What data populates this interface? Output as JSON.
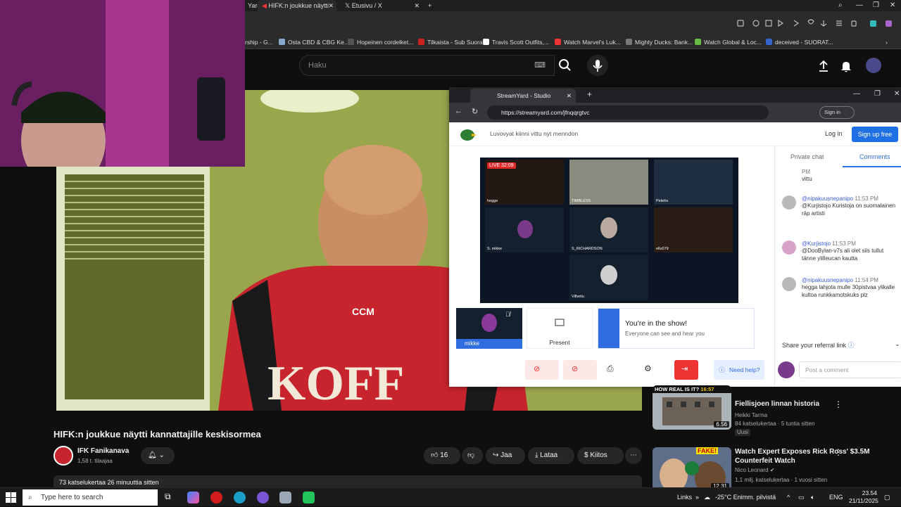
{
  "browser": {
    "tabs": [
      {
        "label": "HIFK:n joukkue näytti",
        "active": true
      },
      {
        "label": "Etusivu / X",
        "active": false
      }
    ],
    "prev_tab_fragment": "Yardi",
    "bookmarks": [
      {
        "label": "rship - G...",
        "color": "#e44"
      },
      {
        "label": "Osta CBD & CBG Ke...",
        "color": "#8ac"
      },
      {
        "label": "Hopeinen cordelket...",
        "color": "#333"
      },
      {
        "label": "Tilkaista - Sub Suora",
        "color": "#c22"
      },
      {
        "label": "Travis Scott Outfits,...",
        "color": "#fff"
      },
      {
        "label": "Watch Marvel's Luk...",
        "color": "#e33"
      },
      {
        "label": "Mighty Ducks: Bank...",
        "color": "#555"
      },
      {
        "label": "Watch Global & Loc...",
        "color": "#6b4"
      },
      {
        "label": "deceived - SUORAT...",
        "color": "#36c"
      }
    ]
  },
  "youtube": {
    "search_placeholder": "Haku",
    "video_title": "HIFK:n joukkue näytti kannattajille keskisormea",
    "channel_name": "IFK Fanikanava",
    "subscribers": "1,58 t. tilaajaa",
    "likes": "16",
    "share": "Jaa",
    "download": "Lataa",
    "thanks": "Kiitos",
    "views_desc": "73 katselukertaa  26 minuuttia sitten",
    "recommendations": [
      {
        "title": "Fiellisjoen linnan historia",
        "channel": "Heikki Tarma",
        "meta": "84 katselukertaa · 5 tuntia sitten",
        "badge": "Uusi",
        "duration": "6.56",
        "banner": "HOW REAL IS IT?",
        "banner_time": "16:57"
      },
      {
        "title": "Watch Expert Exposes Rick Ross' $3.5M Counterfeit Watch",
        "channel": "Nico Leonard",
        "meta": "1,1 milj. katselukertaa · 1 vuosi sitten",
        "duration": "12.31",
        "badge": "",
        "thumb_text": "FAKE!"
      }
    ]
  },
  "streamyard": {
    "tab_title": "StreamYard - Studio",
    "url": "https://streamyard.com/jfnqqrgtvc",
    "sign_in": "Sign in",
    "header_text": "Luvovyat kiinni vittu nyt menndon",
    "login": "Log in",
    "signup": "Sign up free",
    "live_timer": "LIVE 32:09",
    "tiles": [
      "hegge",
      "TIMBLESS",
      "Petelrs",
      "S. mikke",
      "S_RICHARDSON",
      "ellu079",
      "Vilheitu"
    ],
    "self_name": "mikke",
    "present": "Present",
    "in_show_title": "You're in the show!",
    "in_show_sub": "Everyone can see and hear you",
    "need_help": "Need help?",
    "tabs": [
      "Private chat",
      "Comments"
    ],
    "comments": [
      {
        "name": "",
        "time": "PM",
        "text": "vittu"
      },
      {
        "name": "@nipakuusnepanipo",
        "time": "11:53 PM",
        "text": "@Kurjistojo Kuristoja on suomalainen räp artisti"
      },
      {
        "name": "@Kurjistojo",
        "time": "11:53 PM",
        "text": "@DooBylan-v7s ali olet siis tullut tänne ylilleucan kautta"
      },
      {
        "name": "@nipakuusnepanipo",
        "time": "11:54 PM",
        "text": "hegga lahjota mulle 30pistvaa ylikalle kultoa runkkamotskuks plz"
      }
    ],
    "referral": "Share your referral link",
    "post_placeholder": "Post a comment"
  },
  "taskbar": {
    "search_placeholder": "Type here to search",
    "links": "Links",
    "weather": "-25°C  Enimm. pilvistä",
    "lang": "ENG",
    "time": "23.54",
    "date": "21/11/2025"
  }
}
